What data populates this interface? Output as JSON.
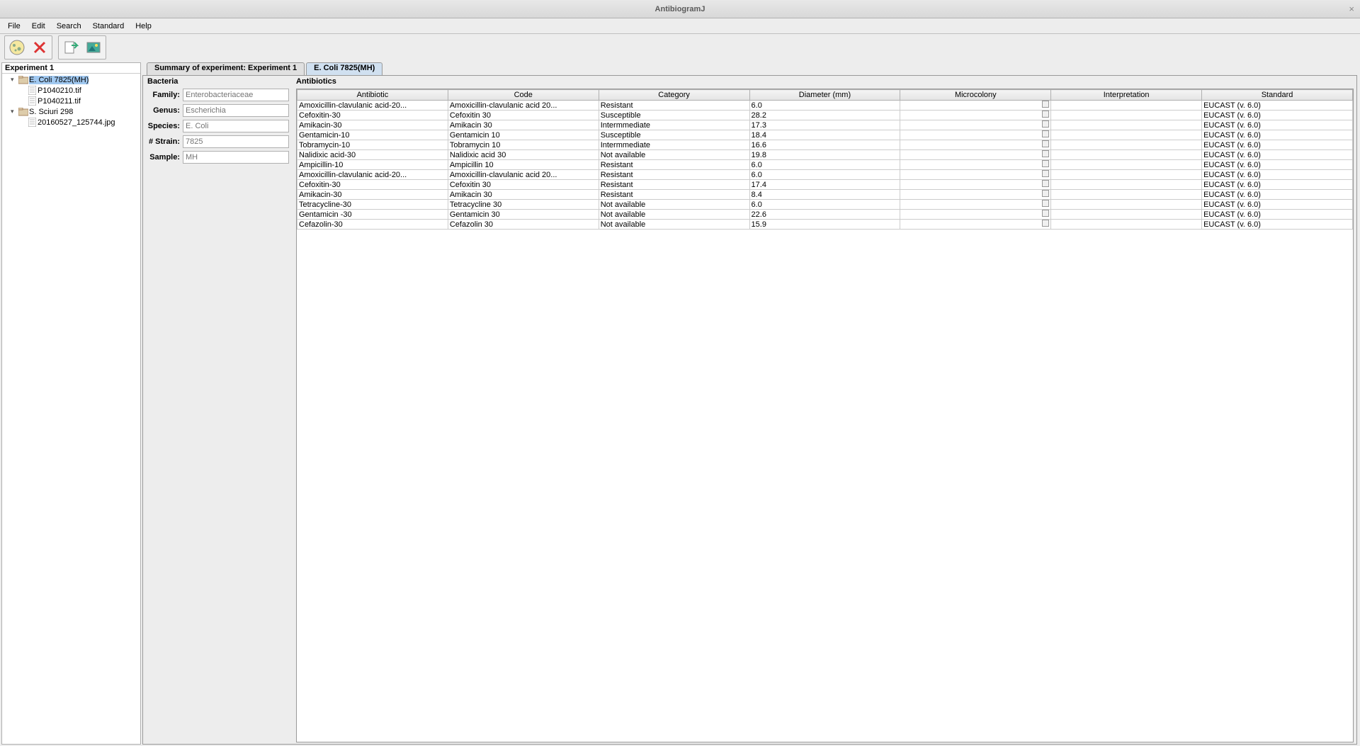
{
  "window": {
    "title": "AntibiogramJ"
  },
  "menu": {
    "file": "File",
    "edit": "Edit",
    "search": "Search",
    "standard": "Standard",
    "help": "Help"
  },
  "tree": {
    "root": "Experiment 1",
    "nodes": [
      {
        "label": "E. Coli 7825(MH)",
        "type": "folder",
        "selected": true,
        "indent": 1
      },
      {
        "label": "P1040210.tif",
        "type": "file",
        "indent": 2
      },
      {
        "label": "P1040211.tif",
        "type": "file",
        "indent": 2
      },
      {
        "label": "S. Sciuri 298",
        "type": "folder",
        "indent": 1
      },
      {
        "label": "20160527_125744.jpg",
        "type": "file",
        "indent": 2
      }
    ]
  },
  "tabs": [
    {
      "label": "Summary of experiment: Experiment 1",
      "active": false
    },
    {
      "label": "E. Coli 7825(MH)",
      "active": true
    }
  ],
  "bacteria": {
    "title": "Bacteria",
    "family_label": "Family:",
    "family_value": "Enterobacteriaceae",
    "genus_label": "Genus:",
    "genus_value": "Escherichia",
    "species_label": "Species:",
    "species_value": "E. Coli",
    "strain_label": "# Strain:",
    "strain_value": "7825",
    "sample_label": "Sample:",
    "sample_value": "MH"
  },
  "antibiotics": {
    "title": "Antibiotics",
    "headers": [
      "Antibiotic",
      "Code",
      "Category",
      "Diameter (mm)",
      "Microcolony",
      "Interpretation",
      "Standard"
    ],
    "rows": [
      {
        "antibiotic": "Amoxicillin-clavulanic acid-20...",
        "code": "Amoxicillin-clavulanic acid 20...",
        "category": "Resistant",
        "diameter": "6.0",
        "interpretation": "",
        "standard": "EUCAST (v. 6.0)"
      },
      {
        "antibiotic": "Cefoxitin-30",
        "code": "Cefoxitin 30",
        "category": "Susceptible",
        "diameter": "28.2",
        "interpretation": "",
        "standard": "EUCAST (v. 6.0)"
      },
      {
        "antibiotic": "Amikacin-30",
        "code": "Amikacin 30",
        "category": "Intermmediate",
        "diameter": "17.3",
        "interpretation": "",
        "standard": "EUCAST (v. 6.0)"
      },
      {
        "antibiotic": "Gentamicin-10",
        "code": "Gentamicin 10",
        "category": "Susceptible",
        "diameter": "18.4",
        "interpretation": "",
        "standard": "EUCAST (v. 6.0)"
      },
      {
        "antibiotic": "Tobramycin-10",
        "code": "Tobramycin 10",
        "category": "Intermmediate",
        "diameter": "16.6",
        "interpretation": "",
        "standard": "EUCAST (v. 6.0)"
      },
      {
        "antibiotic": "Nalidixic acid-30",
        "code": "Nalidixic acid 30",
        "category": "Not available",
        "diameter": "19.8",
        "interpretation": "",
        "standard": "EUCAST (v. 6.0)"
      },
      {
        "antibiotic": "Ampicillin-10",
        "code": "Ampicillin 10",
        "category": "Resistant",
        "diameter": "6.0",
        "interpretation": "",
        "standard": "EUCAST (v. 6.0)"
      },
      {
        "antibiotic": "Amoxicillin-clavulanic acid-20...",
        "code": "Amoxicillin-clavulanic acid 20...",
        "category": "Resistant",
        "diameter": "6.0",
        "interpretation": "",
        "standard": "EUCAST (v. 6.0)"
      },
      {
        "antibiotic": "Cefoxitin-30",
        "code": "Cefoxitin 30",
        "category": "Resistant",
        "diameter": "17.4",
        "interpretation": "",
        "standard": "EUCAST (v. 6.0)"
      },
      {
        "antibiotic": "Amikacin-30",
        "code": "Amikacin 30",
        "category": "Resistant",
        "diameter": "8.4",
        "interpretation": "",
        "standard": "EUCAST (v. 6.0)"
      },
      {
        "antibiotic": "Tetracycline-30",
        "code": "Tetracycline 30",
        "category": "Not available",
        "diameter": "6.0",
        "interpretation": "",
        "standard": "EUCAST (v. 6.0)"
      },
      {
        "antibiotic": "Gentamicin -30",
        "code": "Gentamicin  30",
        "category": "Not available",
        "diameter": "22.6",
        "interpretation": "",
        "standard": "EUCAST (v. 6.0)"
      },
      {
        "antibiotic": "Cefazolin-30",
        "code": "Cefazolin 30",
        "category": "Not available",
        "diameter": "15.9",
        "interpretation": "",
        "standard": "EUCAST (v. 6.0)"
      }
    ]
  }
}
